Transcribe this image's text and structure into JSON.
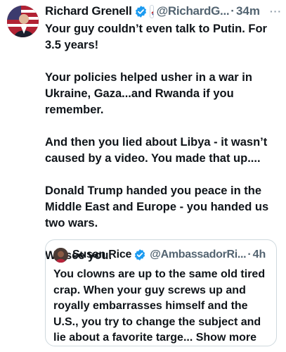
{
  "tweet": {
    "author_name": "Richard Grenell",
    "author_handle": "@RichardG...",
    "separator": "·",
    "time": "34m",
    "more_icon": "more-horizontal-icon",
    "paragraphs": [
      "Your guy couldn’t even talk to Putin. For 3.5 years!",
      "Your policies helped usher in a war in Ukraine, Gaza...and Rwanda if you remember.",
      "And then you lied about Libya - it wasn’t caused by a video. You made that up....",
      "Donald Trump handed you peace in the Middle East and Europe - you handed us two wars.",
      "We see you."
    ]
  },
  "quote": {
    "author_name": "Susan Rice",
    "author_handle": "@AmbassadorRi...",
    "separator": "·",
    "time": "4h",
    "text": "You clowns are up to the same old tired crap. When your guy screws up and royally embarrasses himself and the U.S., you try to change the subject and lie about a favorite targe...",
    "show_more": "Show more"
  },
  "colors": {
    "verified_blue": "#1d9bf0",
    "secondary_text": "#536471",
    "border": "#cfd9de"
  }
}
